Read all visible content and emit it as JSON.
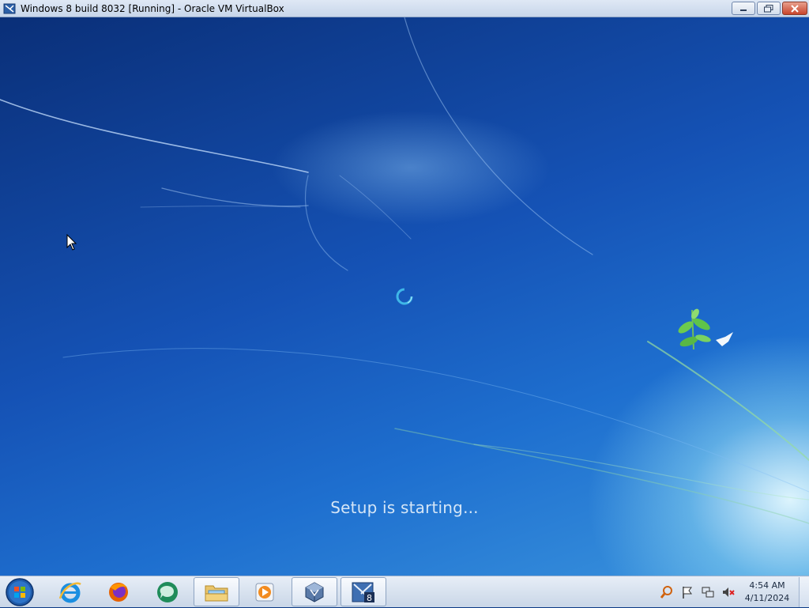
{
  "window": {
    "title": "Windows 8 build 8032 [Running] - Oracle VM VirtualBox",
    "controls": {
      "minimize": "minimize-icon",
      "restore": "restore-icon",
      "close": "close-icon"
    }
  },
  "setup": {
    "status_text": "Setup is starting..."
  },
  "taskbar": {
    "items": [
      {
        "icon": "start-orb-icon",
        "active": false
      },
      {
        "icon": "internet-explorer-icon",
        "active": false
      },
      {
        "icon": "firefox-icon",
        "active": false
      },
      {
        "icon": "chat-app-icon",
        "active": false
      },
      {
        "icon": "file-explorer-icon",
        "active": true
      },
      {
        "icon": "media-player-icon",
        "active": false
      },
      {
        "icon": "virtualbox-icon",
        "active": true
      },
      {
        "icon": "windows-8-vm-icon",
        "active": true
      }
    ],
    "tray_icons": [
      "search-icon",
      "action-center-flag-icon",
      "network-icon",
      "volume-muted-icon"
    ],
    "clock_time": "4:54 AM",
    "clock_date": "4/11/2024"
  },
  "colors": {
    "desktop_dark": "#0a2f78",
    "desktop_mid": "#1e6fcf",
    "setup_text": "#d5e6f7",
    "taskbar": "#dbe5f2",
    "close_button": "#c8452c"
  }
}
